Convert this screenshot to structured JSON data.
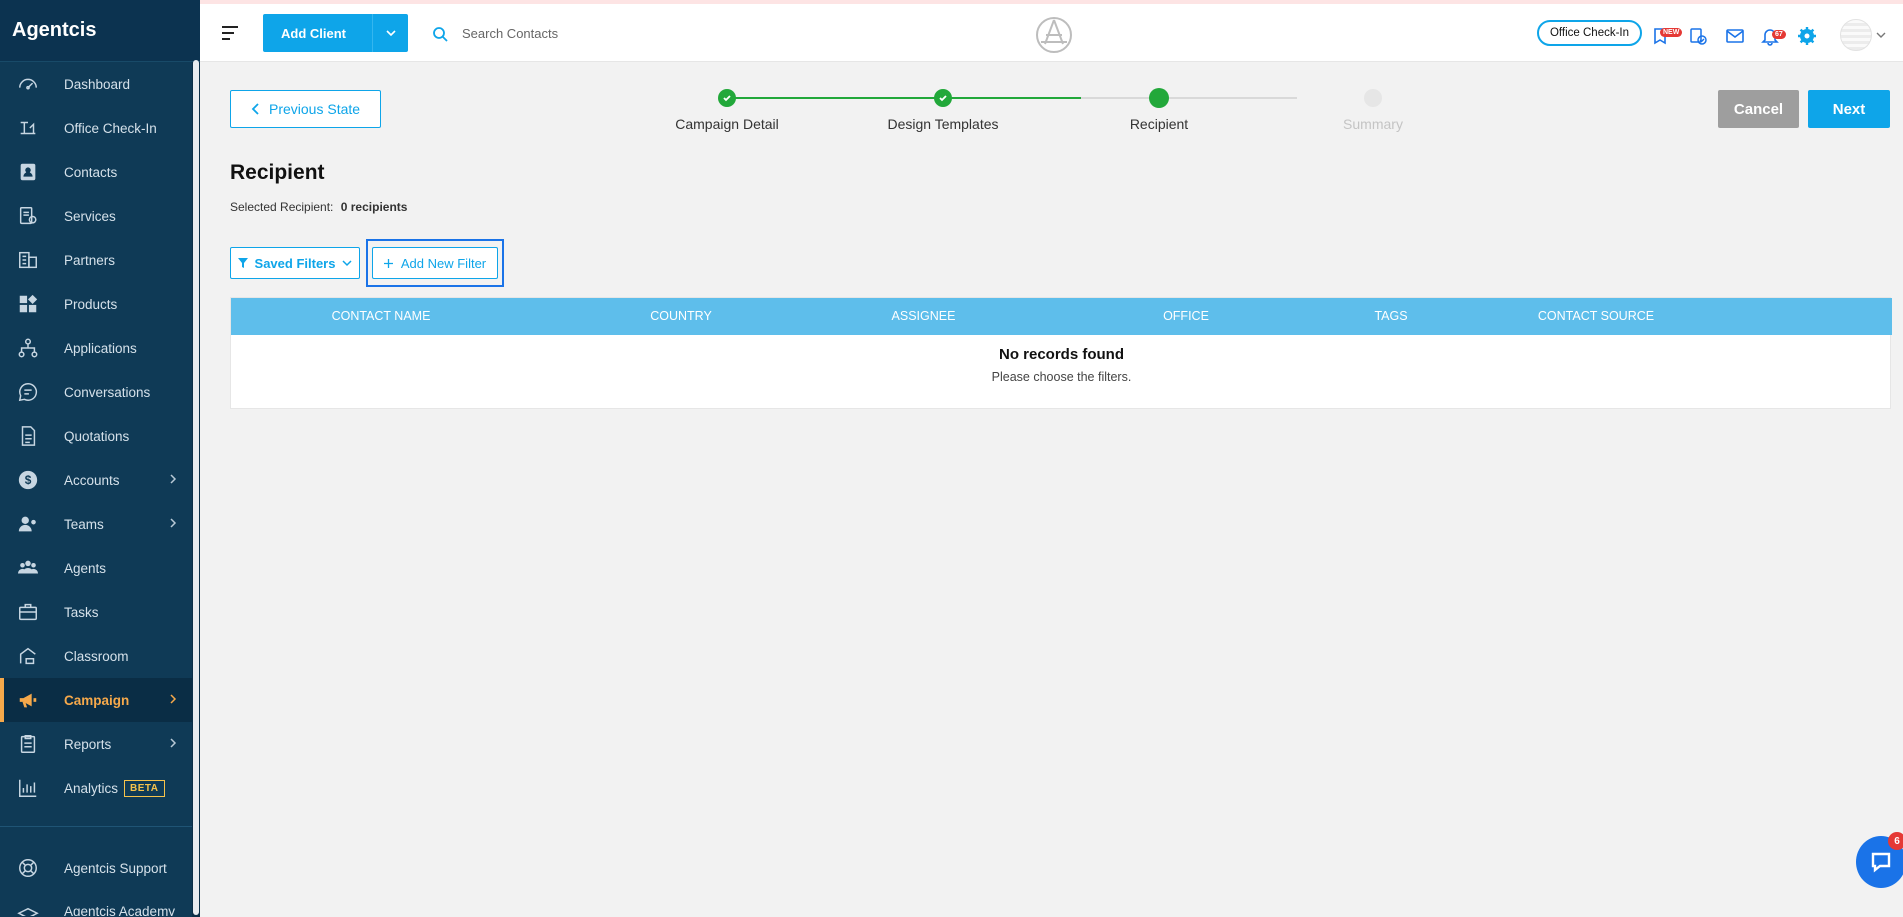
{
  "app": {
    "brand": "Agentcis"
  },
  "sidebar": {
    "items": [
      {
        "label": "Dashboard",
        "icon": "gauge-icon"
      },
      {
        "label": "Office Check-In",
        "icon": "office-checkin-icon"
      },
      {
        "label": "Contacts",
        "icon": "contacts-icon"
      },
      {
        "label": "Services",
        "icon": "services-icon"
      },
      {
        "label": "Partners",
        "icon": "partners-icon"
      },
      {
        "label": "Products",
        "icon": "products-icon"
      },
      {
        "label": "Applications",
        "icon": "applications-icon"
      },
      {
        "label": "Conversations",
        "icon": "conversations-icon"
      },
      {
        "label": "Quotations",
        "icon": "quotations-icon"
      },
      {
        "label": "Accounts",
        "icon": "dollar-icon"
      },
      {
        "label": "Teams",
        "icon": "teams-icon"
      },
      {
        "label": "Agents",
        "icon": "agents-icon"
      },
      {
        "label": "Tasks",
        "icon": "briefcase-icon"
      },
      {
        "label": "Classroom",
        "icon": "classroom-icon"
      },
      {
        "label": "Campaign",
        "icon": "megaphone-icon"
      },
      {
        "label": "Reports",
        "icon": "reports-icon"
      },
      {
        "label": "Analytics",
        "icon": "analytics-icon",
        "badge": "BETA"
      },
      {
        "label": "Agentcis Support",
        "icon": "lifebuoy-icon"
      },
      {
        "label": "Agentcis Academy",
        "icon": "academy-icon"
      }
    ],
    "active": "Campaign"
  },
  "topbar": {
    "add_client_label": "Add Client",
    "search_placeholder": "Search Contacts",
    "office_checkin_label": "Office Check-In",
    "new_badge": "NEW",
    "notification_count": "67"
  },
  "content": {
    "previous_state_label": "Previous State",
    "steps": [
      {
        "label": "Campaign Detail",
        "state": "done"
      },
      {
        "label": "Design Templates",
        "state": "done"
      },
      {
        "label": "Recipient",
        "state": "current"
      },
      {
        "label": "Summary",
        "state": "pending"
      }
    ],
    "cancel_label": "Cancel",
    "next_label": "Next",
    "page_title": "Recipient",
    "selected_recipient_label": "Selected Recipient:",
    "selected_recipient_value": "0 recipients",
    "saved_filters_label": "Saved Filters",
    "add_new_filter_label": "Add New Filter",
    "table": {
      "columns": [
        "CONTACT NAME",
        "COUNTRY",
        "ASSIGNEE",
        "OFFICE",
        "TAGS",
        "CONTACT SOURCE"
      ],
      "empty_title": "No records found",
      "empty_subtitle": "Please choose the filters."
    }
  },
  "chat": {
    "badge": "6"
  },
  "colors": {
    "accent": "#0ea5e9",
    "sidebar_bg": "#0f3a56",
    "active_nav": "#f6a94b",
    "step_done": "#22a83a",
    "table_header": "#5ebeeb",
    "cancel": "#9e9e9e"
  }
}
